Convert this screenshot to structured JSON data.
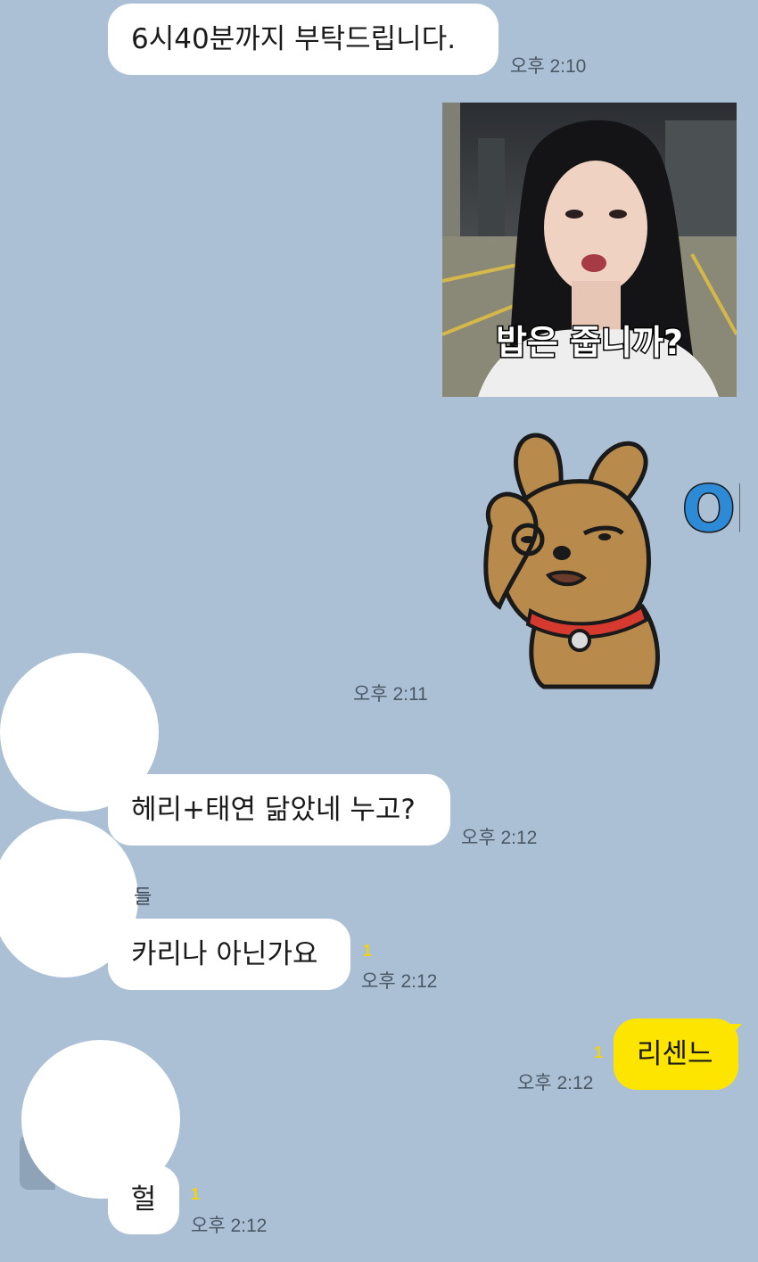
{
  "messages": [
    {
      "text": "6시40분까지 부탁드립니다.",
      "time": "오후 2:10"
    },
    {
      "photo_caption": "밥은 줍니까?"
    },
    {
      "sticker": "ok-dog-sticker",
      "sticker_text": "OK",
      "time": "오후 2:11"
    },
    {
      "text": "헤리+태연 닮았네 누고?",
      "time": "오후 2:12"
    },
    {
      "sender_fragment": "들"
    },
    {
      "text": "카리나 아닌가요",
      "unread": "1",
      "time": "오후 2:12"
    },
    {
      "text": "리센느",
      "unread": "1",
      "time": "오후 2:12"
    },
    {
      "text": "헐",
      "unread": "1",
      "time": "오후 2:12"
    }
  ],
  "colors": {
    "background": "#abc0d5",
    "incoming_bubble": "#ffffff",
    "outgoing_bubble": "#fee500",
    "unread_count": "#f2d30a"
  }
}
